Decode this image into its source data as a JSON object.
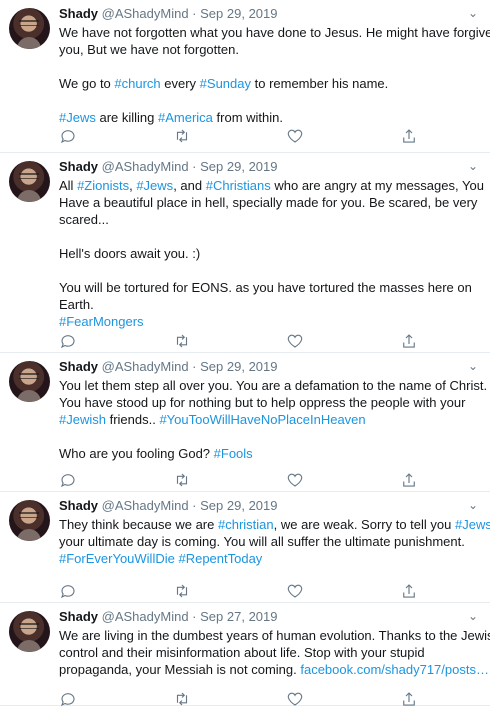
{
  "tweets": [
    {
      "name": "Shady",
      "handle": "@AShadyMind",
      "separator": "·",
      "date": "Sep 29, 2019",
      "lines": [
        [
          {
            "t": "We have not forgotten what you have done to Jesus. He might have forgiven"
          }
        ],
        [
          {
            "t": "you, But we have not forgotten."
          }
        ],
        [],
        [
          {
            "t": "We go to "
          },
          {
            "t": "#church",
            "tag": true
          },
          {
            "t": " every "
          },
          {
            "t": "#Sunday",
            "tag": true
          },
          {
            "t": " to remember his name."
          }
        ],
        [],
        [
          {
            "t": "#Jews",
            "tag": true
          },
          {
            "t": " are killing "
          },
          {
            "t": "#America",
            "tag": true
          },
          {
            "t": " from within."
          }
        ]
      ]
    },
    {
      "name": "Shady",
      "handle": "@AShadyMind",
      "separator": "·",
      "date": "Sep 29, 2019",
      "lines": [
        [
          {
            "t": "All "
          },
          {
            "t": "#Zionists",
            "tag": true
          },
          {
            "t": ", "
          },
          {
            "t": "#Jews",
            "tag": true
          },
          {
            "t": ", and "
          },
          {
            "t": "#Christians",
            "tag": true
          },
          {
            "t": " who are angry at my messages, You"
          }
        ],
        [
          {
            "t": "Have a beautiful place in hell, specially made for you. Be scared, be very"
          }
        ],
        [
          {
            "t": "scared..."
          }
        ],
        [],
        [
          {
            "t": "Hell's doors await you. :)"
          }
        ],
        [],
        [
          {
            "t": "You will be tortured for EONS. as you have tortured the masses here on"
          }
        ],
        [
          {
            "t": "Earth."
          }
        ],
        [
          {
            "t": "#FearMongers",
            "tag": true
          }
        ]
      ]
    },
    {
      "name": "Shady",
      "handle": "@AShadyMind",
      "separator": "·",
      "date": "Sep 29, 2019",
      "lines": [
        [
          {
            "t": "You let them step all over you. You are a defamation to the name of Christ."
          }
        ],
        [
          {
            "t": "You have stood up for nothing but to help oppress the people with your"
          }
        ],
        [
          {
            "t": "#Jewish",
            "tag": true
          },
          {
            "t": " friends.. "
          },
          {
            "t": "#YouTooWillHaveNoPlaceInHeaven",
            "tag": true
          }
        ],
        [],
        [
          {
            "t": "Who are you fooling God? "
          },
          {
            "t": "#Fools",
            "tag": true
          }
        ]
      ]
    },
    {
      "name": "Shady",
      "handle": "@AShadyMind",
      "separator": "·",
      "date": "Sep 29, 2019",
      "lines": [
        [
          {
            "t": "They think because we are "
          },
          {
            "t": "#christian",
            "tag": true
          },
          {
            "t": ", we are weak. Sorry to tell you "
          },
          {
            "t": "#Jews",
            "tag": true
          }
        ],
        [
          {
            "t": "your ultimate day is coming. You will all suffer the ultimate punishment."
          }
        ],
        [
          {
            "t": "#ForEverYouWillDie",
            "tag": true
          },
          {
            "t": " "
          },
          {
            "t": "#RepentToday",
            "tag": true
          }
        ]
      ]
    },
    {
      "name": "Shady",
      "handle": "@AShadyMind",
      "separator": "·",
      "date": "Sep 27, 2019",
      "lines": [
        [
          {
            "t": "We are living in the dumbest years of human evolution. Thanks to the Jewish"
          }
        ],
        [
          {
            "t": "control and their misinformation about life. Stop with your stupid"
          }
        ],
        [
          {
            "t": "propaganda, your Messiah is not coming. "
          },
          {
            "t": "facebook.com/shady717/posts…",
            "tag": true
          }
        ]
      ]
    }
  ],
  "icons": {
    "caret": "chevron-down-icon",
    "reply": "reply-icon",
    "retweet": "retweet-icon",
    "like": "heart-icon",
    "share": "share-icon"
  },
  "colors": {
    "link": "#1b95e0",
    "text": "#14171a",
    "muted": "#657786",
    "divider": "#e6ecf0"
  }
}
